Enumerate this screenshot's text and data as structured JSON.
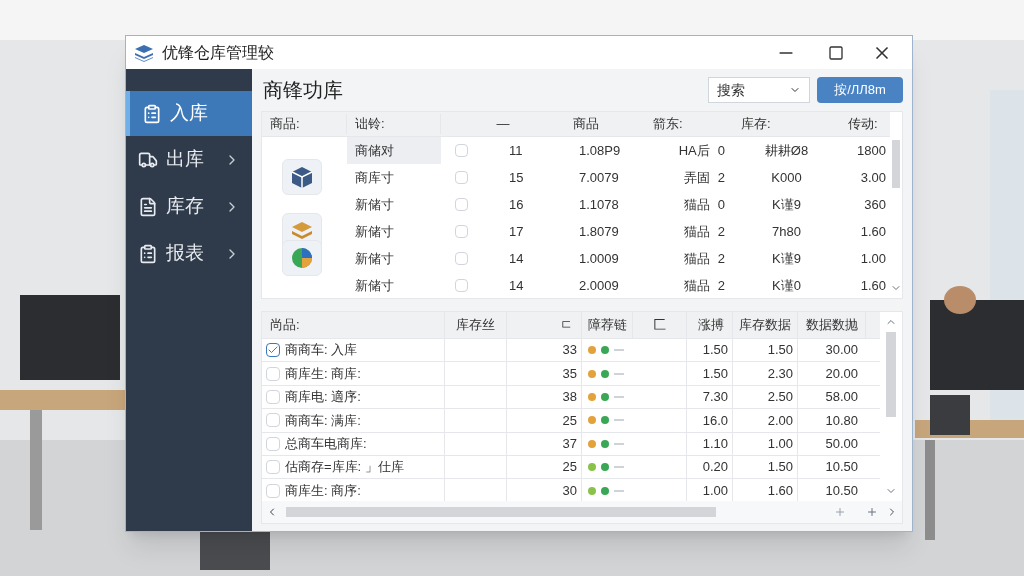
{
  "window": {
    "title": "优锋仓库管理较"
  },
  "sidebar": {
    "items": [
      {
        "label": "入库",
        "selected": true
      },
      {
        "label": "出库",
        "selected": false
      },
      {
        "label": "库存",
        "selected": false
      },
      {
        "label": "报表",
        "selected": false
      }
    ]
  },
  "page": {
    "title": "商锋功库",
    "dropdown": "搜索",
    "button": "按/ЛЛ8m"
  },
  "top_table": {
    "columns": [
      "商品:",
      "诎铃:",
      "—",
      "商品",
      "箭东:",
      "库存:",
      "传动:"
    ],
    "rows": [
      {
        "thumbnail": false,
        "selected": true,
        "name": "商储对",
        "checked": false,
        "number": "11",
        "value": "1.08P9",
        "code": "HA后",
        "digit": "0",
        "ref": "耕耕Ø8",
        "amount": "1800"
      },
      {
        "thumbnail": true,
        "selected": false,
        "name": "商库寸",
        "checked": false,
        "number": "15",
        "value": "7.0079",
        "code": "弄固",
        "digit": "2",
        "ref": "K000",
        "amount": "3.00"
      },
      {
        "thumbnail": false,
        "selected": false,
        "name": "新储寸",
        "checked": false,
        "number": "16",
        "value": "1.1078",
        "code": "猫品",
        "digit": "0",
        "ref": "K谨9",
        "amount": "360"
      },
      {
        "thumbnail": true,
        "selected": false,
        "name": "新储寸",
        "checked": false,
        "number": "17",
        "value": "1.8079",
        "code": "猫品",
        "digit": "2",
        "ref": "7h80",
        "amount": "1.60"
      },
      {
        "thumbnail": true,
        "selected": false,
        "name": "新储寸",
        "checked": false,
        "number": "14",
        "value": "1.0009",
        "code": "猫品",
        "digit": "2",
        "ref": "K谨9",
        "amount": "1.00"
      },
      {
        "thumbnail": false,
        "selected": false,
        "name": "新储寸",
        "checked": false,
        "number": "14",
        "value": "2.0009",
        "code": "猫品",
        "digit": "2",
        "ref": "K谨0",
        "amount": "1.60"
      }
    ]
  },
  "bottom_table": {
    "columns": [
      "尚品:",
      "库存丝",
      "ㄷ",
      "障荐链",
      "匚",
      "涨搏",
      "库存数据",
      "数据数抛"
    ],
    "rows": [
      {
        "checked": true,
        "name": "商商车: 入库",
        "qty": "33",
        "dots": [
          {
            "color": "#e3a23b"
          },
          {
            "color": "#3aa757"
          }
        ],
        "rate": "1.50",
        "stock": "1.50",
        "total": "30.00"
      },
      {
        "checked": false,
        "name": "商库生: 商库:",
        "qty": "35",
        "dots": [
          {
            "color": "#e3a23b"
          },
          {
            "color": "#3aa757"
          }
        ],
        "rate": "1.50",
        "stock": "2.30",
        "total": "20.00"
      },
      {
        "checked": false,
        "name": "商库电: 適序:",
        "qty": "38",
        "dots": [
          {
            "color": "#e3a23b"
          },
          {
            "color": "#3aa757"
          }
        ],
        "rate": "7.30",
        "stock": "2.50",
        "total": "58.00"
      },
      {
        "checked": false,
        "name": "商商车: 满库:",
        "qty": "25",
        "dots": [
          {
            "color": "#e3a23b"
          },
          {
            "color": "#3aa757"
          }
        ],
        "rate": "16.0",
        "stock": "2.00",
        "total": "10.80"
      },
      {
        "checked": false,
        "name": "总商车电商库:",
        "qty": "37",
        "dots": [
          {
            "color": "#e3a23b"
          },
          {
            "color": "#3aa757"
          }
        ],
        "rate": "1.10",
        "stock": "1.00",
        "total": "50.00"
      },
      {
        "checked": false,
        "name": "估商存=库库: 」仕库",
        "qty": "25",
        "dots": [
          {
            "color": "#8bc34a"
          },
          {
            "color": "#3aa757"
          }
        ],
        "rate": "0.20",
        "stock": "1.50",
        "total": "10.50"
      },
      {
        "checked": false,
        "name": "商库生: 商序:",
        "qty": "30",
        "dots": [
          {
            "color": "#8bc34a"
          },
          {
            "color": "#3aa757"
          }
        ],
        "rate": "1.00",
        "stock": "1.60",
        "total": "10.50"
      }
    ]
  }
}
